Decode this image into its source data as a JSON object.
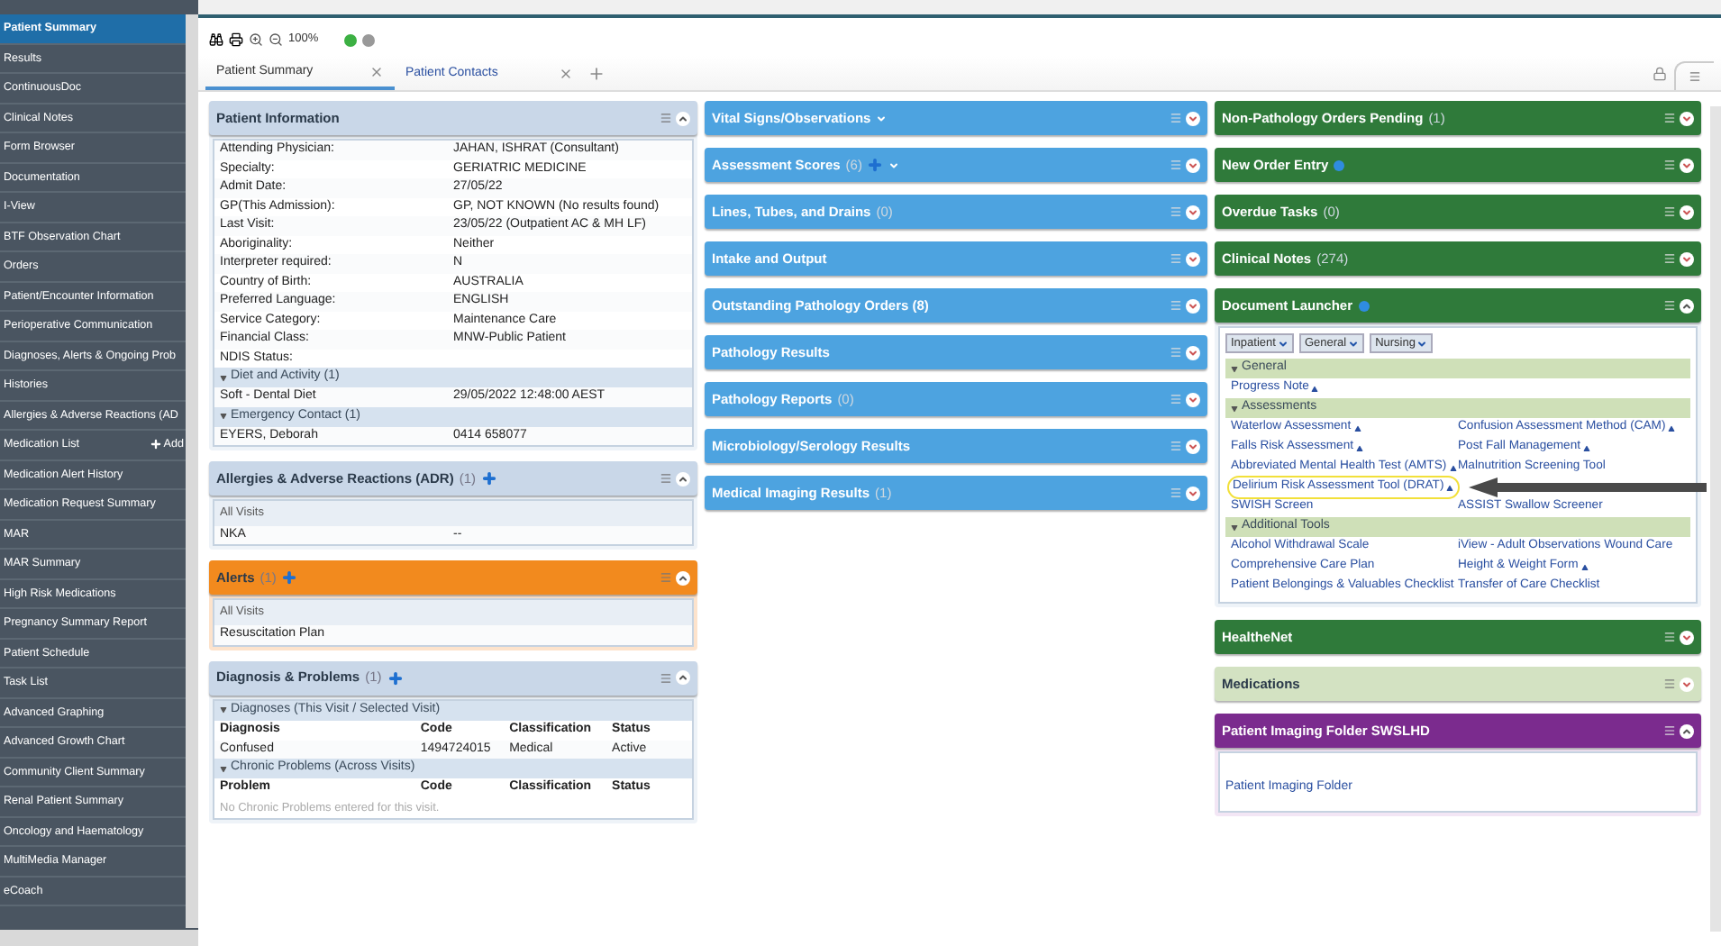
{
  "sidebar": {
    "items": [
      {
        "label": "Patient Summary",
        "selected": true
      },
      {
        "label": "Results",
        "selected": false
      },
      {
        "label": "ContinuousDoc",
        "selected": false
      },
      {
        "label": "Clinical Notes",
        "selected": false
      },
      {
        "label": "Form Browser",
        "selected": false
      },
      {
        "label": "Documentation",
        "selected": false
      },
      {
        "label": "I-View",
        "selected": false
      },
      {
        "label": "BTF Observation Chart",
        "selected": false
      },
      {
        "label": "Orders",
        "selected": false
      },
      {
        "label": "Patient/Encounter Information",
        "selected": false
      },
      {
        "label": "Perioperative Communication",
        "selected": false
      },
      {
        "label": "Diagnoses, Alerts & Ongoing Prob",
        "selected": false
      },
      {
        "label": "Histories",
        "selected": false
      },
      {
        "label": "Allergies & Adverse Reactions (AD",
        "selected": false
      },
      {
        "label": "Medication List",
        "selected": false,
        "action": "Add"
      },
      {
        "label": "Medication Alert History",
        "selected": false
      },
      {
        "label": "Medication Request Summary",
        "selected": false
      },
      {
        "label": "MAR",
        "selected": false
      },
      {
        "label": "MAR Summary",
        "selected": false
      },
      {
        "label": "High Risk Medications",
        "selected": false
      },
      {
        "label": "Pregnancy Summary Report",
        "selected": false
      },
      {
        "label": "Patient Schedule",
        "selected": false
      },
      {
        "label": "Task List",
        "selected": false
      },
      {
        "label": "Advanced Graphing",
        "selected": false
      },
      {
        "label": "Advanced Growth Chart",
        "selected": false
      },
      {
        "label": "Community Client Summary",
        "selected": false
      },
      {
        "label": "Renal Patient Summary",
        "selected": false
      },
      {
        "label": "Oncology and Haematology",
        "selected": false
      },
      {
        "label": "MultiMedia Manager",
        "selected": false
      },
      {
        "label": "eCoach",
        "selected": false
      }
    ]
  },
  "toolbar": {
    "zoom": "100%"
  },
  "tabs": [
    {
      "label": "Patient Summary",
      "selected": true
    },
    {
      "label": "Patient Contacts",
      "selected": false
    }
  ],
  "columns": [
    [
      {
        "title": "Patient Information",
        "color": "#c9d7e8",
        "expanded": true,
        "body": {
          "sections": [
            {
              "rows": [
                [
                  "Attending Physician:",
                  "JAHAN, ISHRAT (Consultant)"
                ],
                [
                  "Specialty:",
                  "GERIATRIC MEDICINE"
                ],
                [
                  "Admit Date:",
                  "27/05/22"
                ],
                [
                  "GP(This Admission):",
                  "GP, NOT KNOWN (No results found)"
                ],
                [
                  "Last Visit:",
                  "23/05/22 (Outpatient AC & MH LF)"
                ],
                [
                  "Aboriginality:",
                  "Neither"
                ],
                [
                  "Interpreter required:",
                  "N"
                ],
                [
                  "Country of Birth:",
                  "AUSTRALIA"
                ],
                [
                  "Preferred Language:",
                  "ENGLISH"
                ],
                [
                  "Service Category:",
                  "Maintenance Care"
                ],
                [
                  "Financial Class:",
                  "MNW-Public Patient"
                ],
                [
                  "NDIS Status:",
                  ""
                ]
              ]
            },
            {
              "heading": "Diet and Activity (1)",
              "rows": [
                [
                  "Soft - Dental Diet",
                  "29/05/2022 12:48:00 AEST"
                ]
              ]
            },
            {
              "heading": "Emergency Contact (1)",
              "rows": [
                [
                  "EYERS, Deborah",
                  "0414 658077"
                ]
              ]
            }
          ]
        }
      },
      {
        "title": "Allergies & Adverse Reactions (ADR)",
        "count": "(1)",
        "add_button": true,
        "color": "#c9d7e8",
        "expanded": true,
        "body": {
          "subheading": "All Visits",
          "sections": [
            {
              "rows": [
                [
                  "NKA",
                  "--"
                ]
              ]
            }
          ]
        }
      },
      {
        "title": "Alerts",
        "count": "(1)",
        "add_button": true,
        "color": "#f28a1e",
        "expanded": true,
        "body": {
          "subheading": "All Visits",
          "sections": [
            {
              "rows": [
                [
                  "Resuscitation Plan"
                ]
              ]
            }
          ]
        }
      },
      {
        "title": "Diagnosis & Problems",
        "count": "(1)",
        "add_button": true,
        "color": "#c9d7e8",
        "expanded": true,
        "body": {
          "sections": [
            {
              "heading": "Diagnoses (This Visit / Selected Visit)",
              "columns": [
                "Diagnosis",
                "Code",
                "Classification",
                "Status"
              ],
              "rows": [
                [
                  "Confused",
                  "1494724015",
                  "Medical",
                  "Active"
                ]
              ]
            },
            {
              "heading": "Chronic Problems (Across Visits)",
              "columns": [
                "Problem",
                "Code",
                "Classification",
                "Status"
              ],
              "note": "No Chronic Problems entered for this visit."
            }
          ]
        }
      }
    ],
    [
      {
        "title": "Vital Signs/Observations",
        "dropdown": true,
        "color": "#4da3e0",
        "expanded": false
      },
      {
        "title": "Assessment Scores",
        "count": "(6)",
        "add_button": true,
        "dropdown": true,
        "color": "#4da3e0",
        "expanded": false
      },
      {
        "title": "Lines, Tubes, and Drains",
        "count": "(0)",
        "color": "#4da3e0",
        "expanded": false
      },
      {
        "title": "Intake and Output",
        "color": "#4da3e0",
        "expanded": false
      },
      {
        "title": "Outstanding Pathology Orders (8)",
        "color": "#4da3e0",
        "expanded": false
      },
      {
        "title": "Pathology Results",
        "color": "#4da3e0",
        "expanded": false
      },
      {
        "title": "Pathology Reports",
        "count": "(0)",
        "color": "#4da3e0",
        "expanded": false
      },
      {
        "title": "Microbiology/Serology Results",
        "color": "#4da3e0",
        "expanded": false
      },
      {
        "title": "Medical Imaging Results",
        "count": "(1)",
        "color": "#4da3e0",
        "expanded": false
      }
    ],
    [
      {
        "title": "Non-Pathology Orders Pending",
        "count": "(1)",
        "color": "#2f7a3a",
        "expanded": false
      },
      {
        "title": "New Order Entry",
        "info_icon": true,
        "color": "#2f7a3a",
        "expanded": false
      },
      {
        "title": "Overdue Tasks",
        "count": "(0)",
        "color": "#2f7a3a",
        "expanded": false
      },
      {
        "title": "Clinical Notes",
        "count": "(274)",
        "color": "#2f7a3a",
        "expanded": false
      },
      {
        "title": "Document Launcher",
        "info_icon": true,
        "color": "#2f7a3a",
        "expanded": true,
        "body": {
          "filters": [
            "Inpatient",
            "General",
            "Nursing"
          ],
          "sections": [
            {
              "heading": "General",
              "items": [
                {
                  "label": "Progress Note",
                  "launch_icon": true
                }
              ]
            },
            {
              "heading": "Assessments",
              "items": [
                {
                  "label": "Waterlow Assessment",
                  "launch_icon": true
                },
                {
                  "label": "Confusion Assessment Method (CAM)",
                  "launch_icon": true
                },
                {
                  "label": "Falls Risk Assessment",
                  "launch_icon": true
                },
                {
                  "label": "Post Fall Management",
                  "launch_icon": true
                },
                {
                  "label": "Abbreviated Mental Health Test (AMTS)",
                  "launch_icon": true
                },
                {
                  "label": "Malnutrition Screening Tool"
                },
                {
                  "label": "Delirium Risk Assessment Tool (DRAT)",
                  "launch_icon": true,
                  "highlighted": true
                },
                {
                  "label": "SWISH Screen"
                },
                {
                  "label": "ASSIST Swallow Screener"
                }
              ]
            },
            {
              "heading": "Additional Tools",
              "items": [
                {
                  "label": "Alcohol Withdrawal Scale"
                },
                {
                  "label": "iView - Adult Observations Wound Care"
                },
                {
                  "label": "Comprehensive Care Plan"
                },
                {
                  "label": "Height & Weight Form",
                  "launch_icon": true
                },
                {
                  "label": "Patient Belongings & Valuables Checklist"
                },
                {
                  "label": "Transfer of Care Checklist"
                }
              ]
            }
          ]
        }
      },
      {
        "title": "HealtheNet",
        "color": "#2f7a3a",
        "expanded": false
      },
      {
        "title": "Medications",
        "color": "#d3e2c2",
        "expanded": false
      },
      {
        "title": "Patient Imaging Folder SWSLHD",
        "color": "#7b2b8e",
        "expanded": true,
        "body": {
          "links": [
            "Patient Imaging Folder"
          ]
        }
      }
    ]
  ]
}
